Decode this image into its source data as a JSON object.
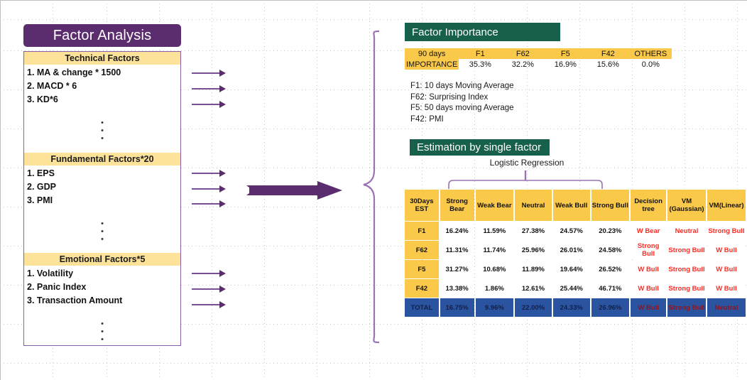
{
  "title_banner": "Factor Analysis",
  "groups": [
    {
      "header": "Technical Factors",
      "items": [
        "1. MA & change * 1500",
        "2. MACD * 6",
        "3. KD*6"
      ]
    },
    {
      "header": "Fundamental Factors*20",
      "items": [
        "1. EPS",
        "2. GDP",
        "3. PMI"
      ]
    },
    {
      "header": "Emotional Factors*5",
      "items": [
        "1.  Volatility",
        "2.  Panic Index",
        "3.  Transaction Amount"
      ]
    }
  ],
  "importance": {
    "header": "Factor Importance",
    "columns": [
      "90 days",
      "F1",
      "F62",
      "F5",
      "F42",
      "OTHERS"
    ],
    "row_label": "IMPORTANCE",
    "values": [
      "35.3%",
      "32.2%",
      "16.9%",
      "15.6%",
      "0.0%"
    ]
  },
  "legend": [
    "F1: 10 days Moving Average",
    "F62: Surprising Index",
    "F5: 50 days moving Average",
    "F42: PMI"
  ],
  "estimation": {
    "header": "Estimation by single factor",
    "group_label": "Logistic Regression",
    "columns": [
      "30Days EST",
      "Strong Bear",
      "Weak Bear",
      "Neutral",
      "Weak Bull",
      "Strong Bull",
      "Decision tree",
      "VM (Gaussian)",
      "VM(Linear)"
    ],
    "rows": [
      {
        "label": "F1",
        "cells": [
          "16.24%",
          "11.59%",
          "27.38%",
          "24.57%",
          "20.23%"
        ],
        "predictions": [
          "W Bear",
          "Neutral",
          "Strong Bull"
        ]
      },
      {
        "label": "F62",
        "cells": [
          "11.31%",
          "11.74%",
          "25.96%",
          "26.01%",
          "24.58%"
        ],
        "predictions": [
          "Strong Bull",
          "Strong Bull",
          "W Bull"
        ]
      },
      {
        "label": "F5",
        "cells": [
          "31.27%",
          "10.68%",
          "11.89%",
          "19.64%",
          "26.52%"
        ],
        "predictions": [
          "W Bull",
          "Strong Bull",
          "W Bull"
        ]
      },
      {
        "label": "F42",
        "cells": [
          "13.38%",
          "1.86%",
          "12.61%",
          "25.44%",
          "46.71%"
        ],
        "predictions": [
          "W Bull",
          "Strong Bull",
          "W Bull"
        ]
      },
      {
        "label": "TOTAL",
        "cells": [
          "16.75%",
          "9.96%",
          "22.00%",
          "24.33%",
          "26.96%"
        ],
        "predictions": [
          "W Bull",
          "Strong Bull",
          "Neutral"
        ],
        "total": true
      }
    ]
  },
  "colors": {
    "brand_purple": "#5c2d6e",
    "arrow_purple": "#7a4f96",
    "header_yellow": "#fbc94a",
    "group_yellow": "#fde39a",
    "green": "#17604c",
    "total_blue": "#2a54a0",
    "prediction_red": "#ff2a22"
  },
  "ellipsis": "•"
}
